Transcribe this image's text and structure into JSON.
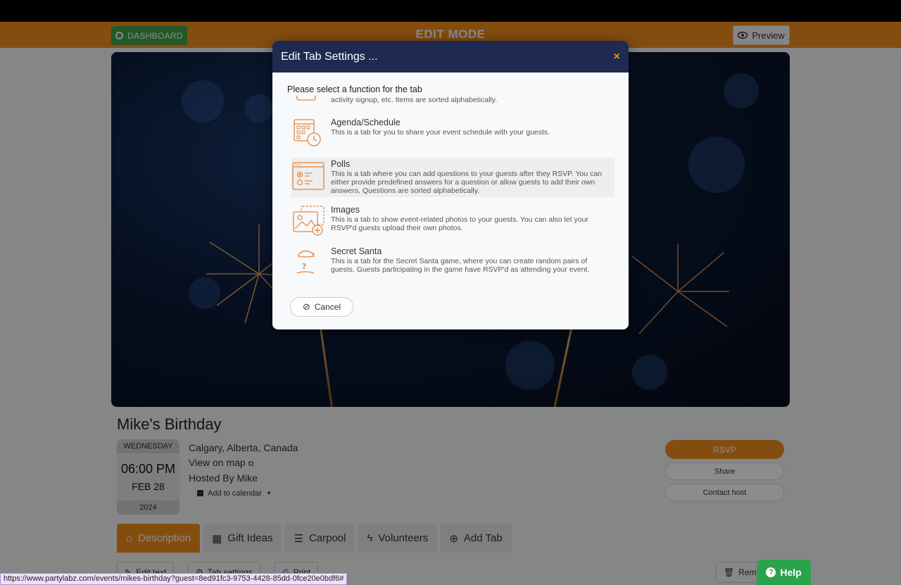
{
  "editbar": {
    "dashboard_label": "DASHBOARD",
    "mode_label": "EDIT MODE",
    "preview_label": "Preview"
  },
  "event": {
    "title": "Mike's Birthday",
    "weekday": "WEDNESDAY",
    "time": "06:00 PM",
    "date": "FEB 28",
    "year": "2024",
    "location": "Calgary, Alberta, Canada",
    "map_link": "View on map",
    "hosted_by": "Hosted By  Mike",
    "add_calendar": "Add to calendar"
  },
  "actions": {
    "rsvp": "RSVP",
    "share": "Share",
    "contact": "Contact host"
  },
  "tabs": [
    {
      "label": "Description"
    },
    {
      "label": "Gift Ideas"
    },
    {
      "label": "Carpool"
    },
    {
      "label": "Volunteers"
    },
    {
      "label": "Add Tab"
    }
  ],
  "toolbar": {
    "edit_text": "Edit text",
    "tab_settings": "Tab settings",
    "print": "Print",
    "remove": "Remo"
  },
  "modal": {
    "title": "Edit Tab Settings ...",
    "close": "×",
    "prompt": "Please select a function for the tab",
    "cancel": "Cancel",
    "functions": [
      {
        "name": "",
        "desc": "with gift suggestions, sub events, menu options, potluck, carpool, rooms signup, activity signup, etc. Items are sorted alphabetically.",
        "icon": "list-icon"
      },
      {
        "name": "Agenda/Schedule",
        "desc": "This is a tab for you to share your event schedule with your guests.",
        "icon": "calendar-clock-icon"
      },
      {
        "name": "Polls",
        "desc": "This is a tab where you can add questions to your guests after they RSVP. You can either provide predefined answers for a question or allow guests to add their own answers. Questions are sorted alphabetically.",
        "icon": "poll-icon"
      },
      {
        "name": "Images",
        "desc": "This is a tab to show event-related photos to your guests. You can also let your RSVP'd guests upload their own photos.",
        "icon": "images-icon"
      },
      {
        "name": "Secret Santa",
        "desc": "This is a tab for the Secret Santa game, where you can create random pairs of guests. Guests participating in the game have RSVP'd as attending your event.",
        "icon": "secret-santa-icon"
      }
    ]
  },
  "status_url": "https://www.partylabz.com/events/mikes-birthday?guest=8ed91fc3-9753-4428-85dd-0fce20e0bdf6#",
  "help_label": "Help",
  "colors": {
    "accent": "#f08c1e",
    "modal_header": "#1e2a52",
    "success": "#43a047"
  }
}
